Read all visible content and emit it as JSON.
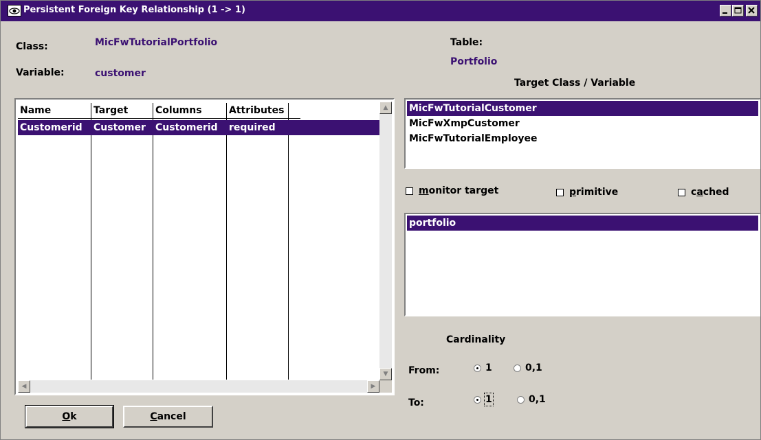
{
  "window": {
    "title": "Persistent Foreign Key Relationship (1 -> 1)",
    "icon": "eye-icon",
    "controls": [
      "minimize-icon",
      "maximize-icon",
      "close-icon"
    ]
  },
  "class_label": "Class:",
  "class_value": "MicFwTutorialPortfolio",
  "variable_label": "Variable:",
  "variable_value": "customer",
  "table_label": "Table:",
  "table_value": "Portfolio",
  "grid": {
    "columns": [
      "Name",
      "Target",
      "Columns",
      "Attributes"
    ],
    "rows": [
      {
        "name": "Customerid",
        "target": "Customer",
        "columns": "Customerid",
        "attributes": "required"
      }
    ]
  },
  "target_header": "Target Class / Variable",
  "target_classes": [
    "MicFwTutorialCustomer",
    "MicFwXmpCustomer",
    "MicFwTutorialEmployee"
  ],
  "options": {
    "monitor_target": {
      "label_u": "m",
      "label_rest": "onitor target",
      "checked": false
    },
    "primitive": {
      "label_u": "p",
      "label_rest": "rimitive",
      "checked": false
    },
    "cached": {
      "label_pre": "c",
      "label_u": "a",
      "label_rest": "ched",
      "checked": false
    }
  },
  "variables": [
    "portfolio"
  ],
  "cardinality": {
    "header": "Cardinality",
    "from_label": "From:",
    "to_label": "To:",
    "opt_one": "1",
    "opt_zero_one": "0,1",
    "from_selected": "1",
    "to_selected": "1"
  },
  "buttons": {
    "ok_u": "O",
    "ok_rest": "k",
    "cancel_u": "C",
    "cancel_rest": "ancel"
  },
  "colors": {
    "titlebar": "#3b1172",
    "selection": "#3b1172",
    "face": "#d4d0c8"
  }
}
